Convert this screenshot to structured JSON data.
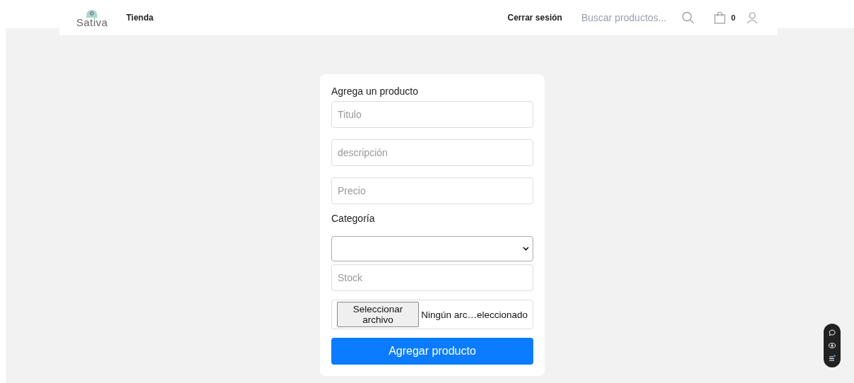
{
  "header": {
    "logo": "Sativa",
    "nav": [
      {
        "label": "Tienda"
      }
    ],
    "logout": "Cerrar sesión",
    "search": {
      "placeholder": "Buscar productos..."
    },
    "cart_count": "0"
  },
  "form": {
    "title": "Agrega un producto",
    "fields": [
      {
        "kind": "text",
        "placeholder": "Titulo"
      },
      {
        "kind": "text",
        "placeholder": "descripción"
      },
      {
        "kind": "text",
        "placeholder": "Precio"
      },
      {
        "kind": "label",
        "text": "Categoría"
      },
      {
        "kind": "select"
      },
      {
        "kind": "text",
        "placeholder": "Stock"
      },
      {
        "kind": "file",
        "button": "Seleccionar archivo",
        "status": "Ningún arc…eleccionado"
      }
    ],
    "submit": "Agregar producto"
  }
}
